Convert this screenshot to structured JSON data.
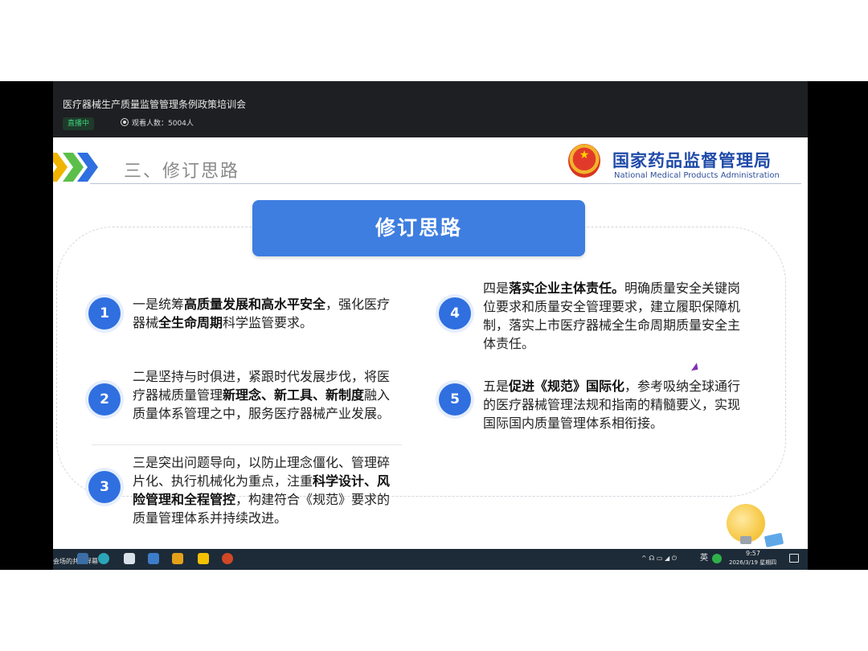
{
  "player": {
    "title": "医疗器械生产质量监管管理条例政策培训会",
    "live_badge": "直播中",
    "viewers": "观看人数：5004人"
  },
  "slide": {
    "heading": "三、修订思路",
    "agency_cn": "国家药品监督管理局",
    "agency_en": "National Medical Products Administration",
    "banner": "修订思路",
    "chevron_colors": [
      "#f0b400",
      "#5cbf4a",
      "#2f6fe0"
    ],
    "items": [
      {
        "num": "1",
        "parts": [
          {
            "t": "一是统筹",
            "b": false
          },
          {
            "t": "高质量发展和高水平安全",
            "b": true
          },
          {
            "t": "，强化医疗器械",
            "b": false
          },
          {
            "t": "全生命周期",
            "b": true
          },
          {
            "t": "科学监管要求。",
            "b": false
          }
        ]
      },
      {
        "num": "2",
        "parts": [
          {
            "t": "二是坚持与时俱进，紧跟时代发展步伐，将医疗器械质量管理",
            "b": false
          },
          {
            "t": "新理念、新工具、新制度",
            "b": true
          },
          {
            "t": "融入质量体系管理之中，服务医疗器械产业发展。",
            "b": false
          }
        ]
      },
      {
        "num": "3",
        "parts": [
          {
            "t": "三是突出问题导向，以防止理念僵化、管理碎片化、执行机械化为重点，注重",
            "b": false
          },
          {
            "t": "科学设计、风险管理和全程管控",
            "b": true
          },
          {
            "t": "，构建符合《规范》要求的质量管理体系并持续改进。",
            "b": false
          }
        ]
      },
      {
        "num": "4",
        "parts": [
          {
            "t": "四是",
            "b": false
          },
          {
            "t": "落实企业主体责任。",
            "b": true
          },
          {
            "t": "明确质量安全关键岗位要求和质量安全管理要求，建立履职保障机制，落实上市医疗器械全生命周期质量安全主体责任。",
            "b": false
          }
        ]
      },
      {
        "num": "5",
        "parts": [
          {
            "t": "五是",
            "b": false
          },
          {
            "t": "促进《规范》国际化",
            "b": true
          },
          {
            "t": "，参考吸纳全球通行的医疗器械管理法规和指南的精髓要义，实现国际国内质量管理体系相衔接。",
            "b": false
          }
        ]
      }
    ]
  },
  "taskbar": {
    "share_label": "会场的共享屏幕",
    "tray_icons": "^ ☊ ▭ ◢ ⏻",
    "ime": "英",
    "time": "9:57",
    "date": "2026/3/19 星期四"
  }
}
